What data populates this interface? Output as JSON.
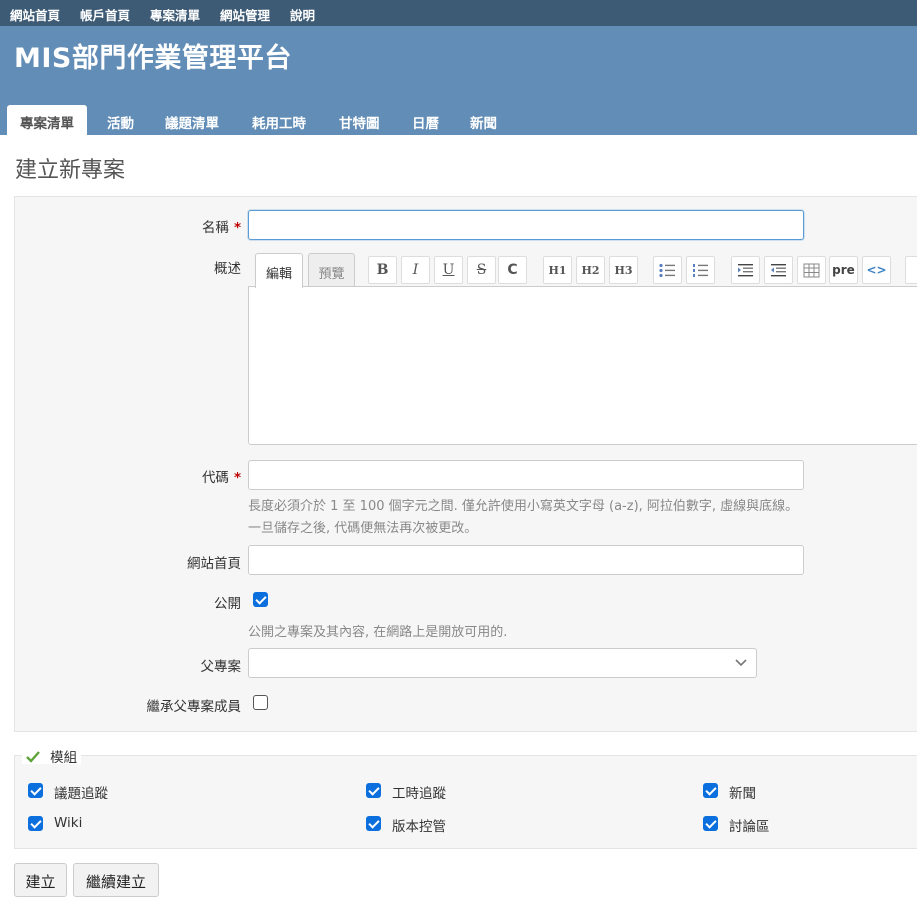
{
  "top_menu": [
    "網站首頁",
    "帳戶首頁",
    "專案清單",
    "網站管理",
    "說明"
  ],
  "site_title": "MIS部門作業管理平台",
  "main_tabs": [
    "專案清單",
    "活動",
    "議題清單",
    "耗用工時",
    "甘特圖",
    "日曆",
    "新聞"
  ],
  "page_title": "建立新專案",
  "form": {
    "name_label": "名稱",
    "required_mark": "*",
    "name_value": "",
    "description_label": "概述",
    "editor_tabs": [
      "編輯",
      "預覽"
    ],
    "toolbar": [
      "bold-icon",
      "italic-icon",
      "underline-icon",
      "strikethrough-icon",
      "code-icon",
      "h1-icon",
      "h2-icon",
      "h3-icon",
      "bullet-list-icon",
      "numbered-list-icon",
      "blockquote-icon",
      "unquote-icon",
      "table-icon",
      "pre-icon",
      "inline-code-icon",
      "image-icon"
    ],
    "toolbar_text": {
      "bold": "B",
      "italic": "I",
      "underline": "U",
      "strike": "S",
      "code": "C",
      "h1": "H1",
      "h2": "H2",
      "h3": "H3",
      "pre": "pre",
      "inline_code": "<>"
    },
    "identifier_label": "代碼",
    "identifier_hint_1": "長度必須介於 1 至 100 個字元之間. 僅允許使用小寫英文字母 (a-z), 阿拉伯數字, 虛線與底線。",
    "identifier_hint_2": "一旦儲存之後, 代碼便無法再次被更改。",
    "homepage_label": "網站首頁",
    "public_label": "公開",
    "public_checked": true,
    "public_hint": "公開之專案及其內容, 在網路上是開放可用的.",
    "parent_label": "父專案",
    "parent_value": "",
    "inherit_label": "繼承父專案成員",
    "inherit_checked": false
  },
  "modules": {
    "legend": "模組",
    "items": [
      {
        "label": "議題追蹤",
        "checked": true
      },
      {
        "label": "工時追蹤",
        "checked": true
      },
      {
        "label": "新聞",
        "checked": true
      },
      {
        "label": "Wiki",
        "checked": true
      },
      {
        "label": "版本控管",
        "checked": true
      },
      {
        "label": "討論區",
        "checked": true
      }
    ]
  },
  "buttons": {
    "create": "建立",
    "create_continue": "繼續建立"
  },
  "colors": {
    "top_menu_bg": "#3e5b76",
    "header_bg": "#628db6",
    "checkbox": "#0b6fde",
    "required": "#bb0000"
  }
}
